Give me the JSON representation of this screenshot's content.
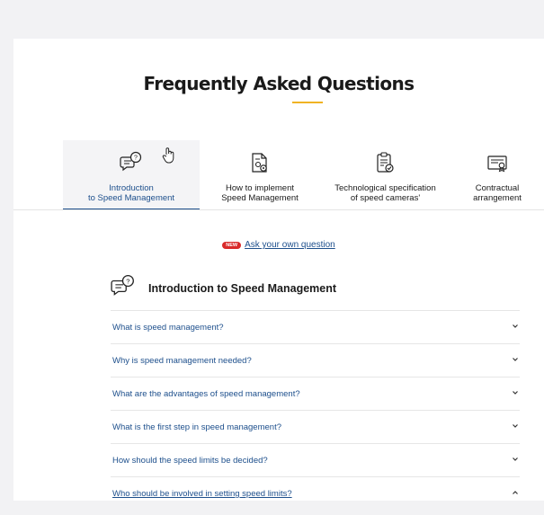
{
  "page": {
    "title": "Frequently Asked Questions",
    "accent_color": "#f0b323",
    "link_color": "#1d4f8c"
  },
  "tabs": [
    {
      "line1": "Introduction",
      "line2": "to Speed Management",
      "icon": "chat-question-icon",
      "active": true
    },
    {
      "line1": "How to implement",
      "line2": "Speed Management",
      "icon": "document-gears-icon",
      "active": false
    },
    {
      "line1": "Technological specification",
      "line2": "of speed cameras'",
      "icon": "clipboard-check-icon",
      "active": false
    },
    {
      "line1": "Contractual",
      "line2": "arrangement",
      "icon": "certificate-icon",
      "active": false
    }
  ],
  "ask": {
    "badge": "NEW",
    "link_text": "Ask your own question"
  },
  "section": {
    "title": "Introduction to Speed Management",
    "icon": "chat-question-icon"
  },
  "faqs": [
    {
      "question": "What is speed management?",
      "open": false
    },
    {
      "question": "Why is speed management needed?",
      "open": false
    },
    {
      "question": "What are the advantages of speed management?",
      "open": false
    },
    {
      "question": "What is the first step in speed management?",
      "open": false
    },
    {
      "question": "How should the speed limits be decided?",
      "open": false
    },
    {
      "question": "Who should be involved in setting speed limits?",
      "open": true
    }
  ]
}
